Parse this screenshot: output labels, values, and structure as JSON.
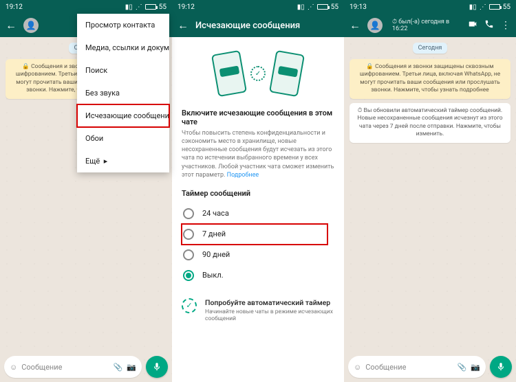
{
  "status": {
    "time1": "19:12",
    "time2": "19:12",
    "time3": "19:13",
    "battery": "55"
  },
  "s1": {
    "today": "Сегодня",
    "sys_msg": "🔒 Сообщения и звонки защищены сквозным шифрованием. Третьи лица, включая WhatsApp, не могут прочитать ваши сообщения или прослушать звонки. Нажмите, чтобы узнать подробнее.",
    "menu": {
      "items": [
        "Просмотр контакта",
        "Медиа, ссылки и докум.",
        "Поиск",
        "Без звука",
        "Исчезающие сообщения",
        "Обои",
        "Ещё"
      ]
    },
    "input_placeholder": "Сообщение"
  },
  "s2": {
    "title": "Исчезающие сообщения",
    "headline": "Включите исчезающие сообщения в этом чате",
    "body": "Чтобы повысить степень конфиденциальности и сэкономить место в хранилище, новые несохраненные сообщения будут исчезать из этого чата по истечении выбранного времени у всех участников. Любой участник чата сможет изменить этот параметр.",
    "learn_more": "Подробнее",
    "timer_header": "Таймер сообщений",
    "options": {
      "o1": "24 часа",
      "o2": "7 дней",
      "o3": "90 дней",
      "o4": "Выкл."
    },
    "try_title": "Попробуйте автоматический таймер",
    "try_body": "Начинайте новые чаты в режиме исчезающих сообщений"
  },
  "s3": {
    "last_seen": "был(-а) сегодня в 16:22",
    "today": "Сегодня",
    "sys_msg1": "🔒 Сообщения и звонки защищены сквозным шифрованием. Третьи лица, включая WhatsApp, не могут прочитать ваши сообщения или прослушать звонки. Нажмите, чтобы узнать подробнее",
    "sys_msg2": "⏱ Вы обновили автоматический таймер сообщений. Новые несохраненные сообщения исчезнут из этого чата через 7 дней после отправки. Нажмите, чтобы изменить.",
    "input_placeholder": "Сообщение"
  }
}
